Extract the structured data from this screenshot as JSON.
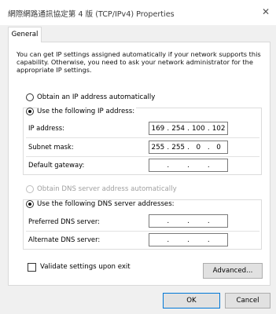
{
  "window": {
    "title": "網際網路通訊協定第 4 版 (TCP/IPv4) Properties",
    "close_glyph": "✕"
  },
  "tabs": [
    {
      "label": "General"
    }
  ],
  "description": "You can get IP settings assigned automatically if your network supports this capability. Otherwise, you need to ask your network administrator for the appropriate IP settings.",
  "ip_section": {
    "auto_option": {
      "label": "Obtain an IP address automatically",
      "selected": false
    },
    "manual_option": {
      "label": "Use the following IP address:",
      "selected": true
    },
    "fields": [
      {
        "label": "IP address:",
        "octets": [
          "169",
          "254",
          "100",
          "102"
        ]
      },
      {
        "label": "Subnet mask:",
        "octets": [
          "255",
          "255",
          "0",
          "0"
        ]
      },
      {
        "label": "Default gateway:",
        "octets": [
          "",
          "",
          "",
          ""
        ]
      }
    ]
  },
  "dns_section": {
    "auto_option": {
      "label": "Obtain DNS server address automatically",
      "selected": false,
      "disabled": true
    },
    "manual_option": {
      "label": "Use the following DNS server addresses:",
      "selected": true
    },
    "fields": [
      {
        "label": "Preferred DNS server:",
        "octets": [
          "",
          "",
          "",
          ""
        ]
      },
      {
        "label": "Alternate DNS server:",
        "octets": [
          "",
          "",
          "",
          ""
        ]
      }
    ]
  },
  "validate": {
    "label": "Validate settings upon exit",
    "checked": false
  },
  "buttons": {
    "advanced": "Advanced...",
    "ok": "OK",
    "cancel": "Cancel"
  }
}
